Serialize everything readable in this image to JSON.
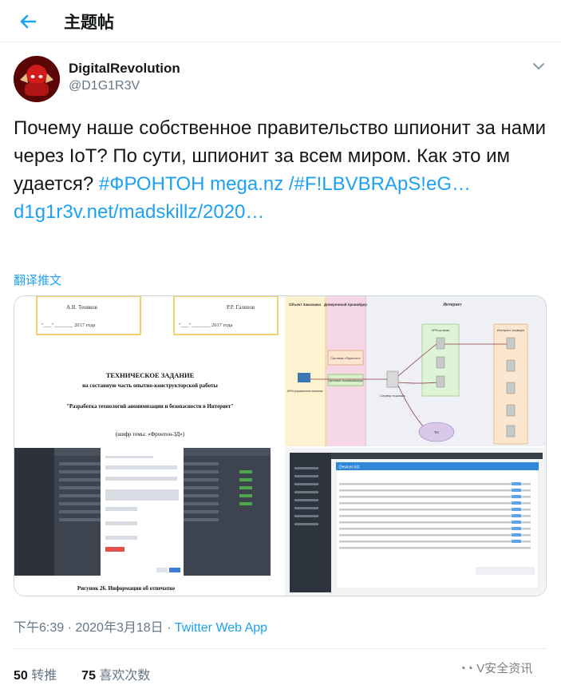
{
  "header": {
    "title": "主题帖"
  },
  "author": {
    "name": "DigitalRevolution",
    "handle": "@D1G1R3V"
  },
  "tweet": {
    "text_plain": "Почему наше собственное правительство шпионит за нами через IoT? По сути, шпионит за всем миром. Как это им удается? ",
    "hashtag": "#ФРОНТОН",
    "link1": "mega.nz /#F!LBVBRApS!eG…",
    "link2": "d1g1r3v.net/madskillz/2020…"
  },
  "translate_label": "翻译推文",
  "media": {
    "doc": {
      "sig_left": "А.В. Теняков",
      "sig_right": "Р.Р. Галяхов",
      "date_left": "\"___\" _______ 2017 года",
      "date_right": "\"___\" _______ 2017 года",
      "title": "ТЕХНИЧЕСКОЕ ЗАДАНИЕ",
      "subtitle": "на составную часть опытно-конструкторской работы",
      "project": "\"Разработка технологий анонимизации и безопасности в Интернет\"",
      "code": "(шифр темы: «Фронтон-ЗД»)"
    },
    "diagram": {
      "col1": "Объект Заказчика",
      "col2": "Доверенный провайдер",
      "col3": "Интернет",
      "component": "Система «Фронтон»",
      "component2": "Целевые анонимайзеры",
      "vpn": "VPN-шлюзы",
      "servers": "Интернет серверы",
      "arm": "АРМ управления заказом",
      "server": "Сервер пошлака",
      "tor": "Tor"
    },
    "caption": "Рисунок 26.  Информация об отпечатке",
    "devices_title": "Devices list"
  },
  "meta": {
    "time": "下午6:39 · 2020年3月18日 · ",
    "app": "Twitter Web App"
  },
  "stats": {
    "retweets_count": "50",
    "retweets_label": "转推",
    "likes_count": "75",
    "likes_label": "喜欢次数"
  },
  "watermark": "V安全资讯",
  "colors": {
    "accent": "#1da1f2",
    "muted": "#657786",
    "text": "#14171a"
  }
}
